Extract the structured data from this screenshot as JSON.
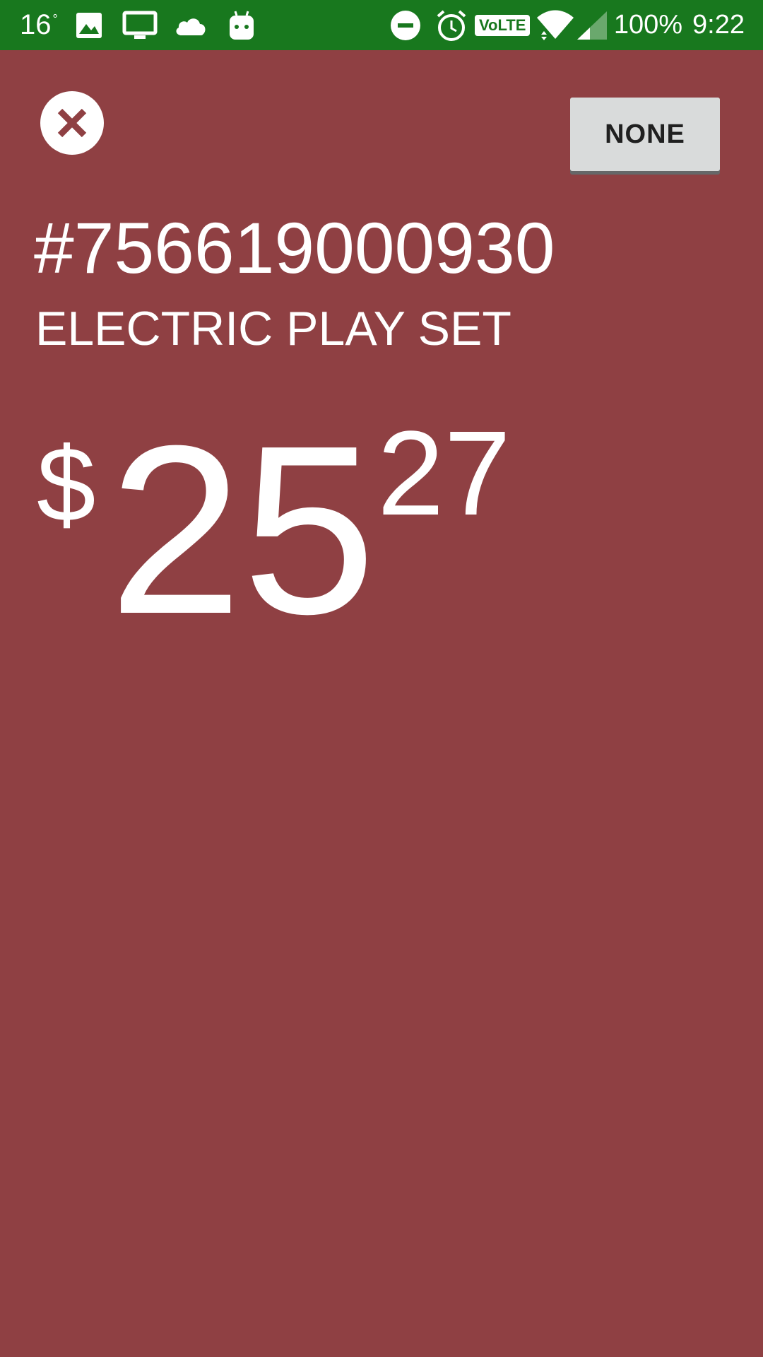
{
  "status_bar": {
    "temperature": "16",
    "degree_symbol": "°",
    "volte_label": "VoLTE",
    "battery": "100%",
    "time": "9:22",
    "icons": [
      "image-icon",
      "tv-icon",
      "cloud-icon",
      "android-icon",
      "do-not-disturb-icon",
      "alarm-icon",
      "volte-icon",
      "wifi-icon",
      "signal-icon"
    ],
    "background": "#18781e"
  },
  "header": {
    "close_icon": "close-icon",
    "none_button_label": "NONE"
  },
  "item": {
    "number": "#756619000930",
    "name": "ELECTRIC PLAY SET"
  },
  "price": {
    "currency": "$",
    "dollars": "25",
    "cents": "27"
  },
  "colors": {
    "background": "#8f4043",
    "button": "#d9dbdb"
  }
}
